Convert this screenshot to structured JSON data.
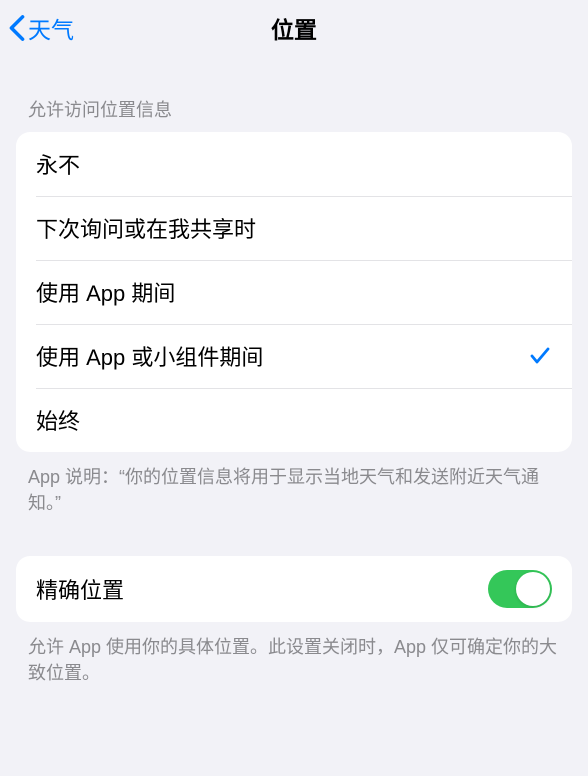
{
  "nav": {
    "back_label": "天气",
    "title": "位置"
  },
  "section1": {
    "header": "允许访问位置信息",
    "options": [
      {
        "label": "永不",
        "selected": false
      },
      {
        "label": "下次询问或在我共享时",
        "selected": false
      },
      {
        "label": "使用 App 期间",
        "selected": false
      },
      {
        "label": "使用 App 或小组件期间",
        "selected": true
      },
      {
        "label": "始终",
        "selected": false
      }
    ],
    "footer": "App 说明：“你的位置信息将用于显示当地天气和发送附近天气通知。”"
  },
  "section2": {
    "precise_label": "精确位置",
    "precise_on": true,
    "footer": "允许 App 使用你的具体位置。此设置关闭时，App 仅可确定你的大致位置。"
  }
}
